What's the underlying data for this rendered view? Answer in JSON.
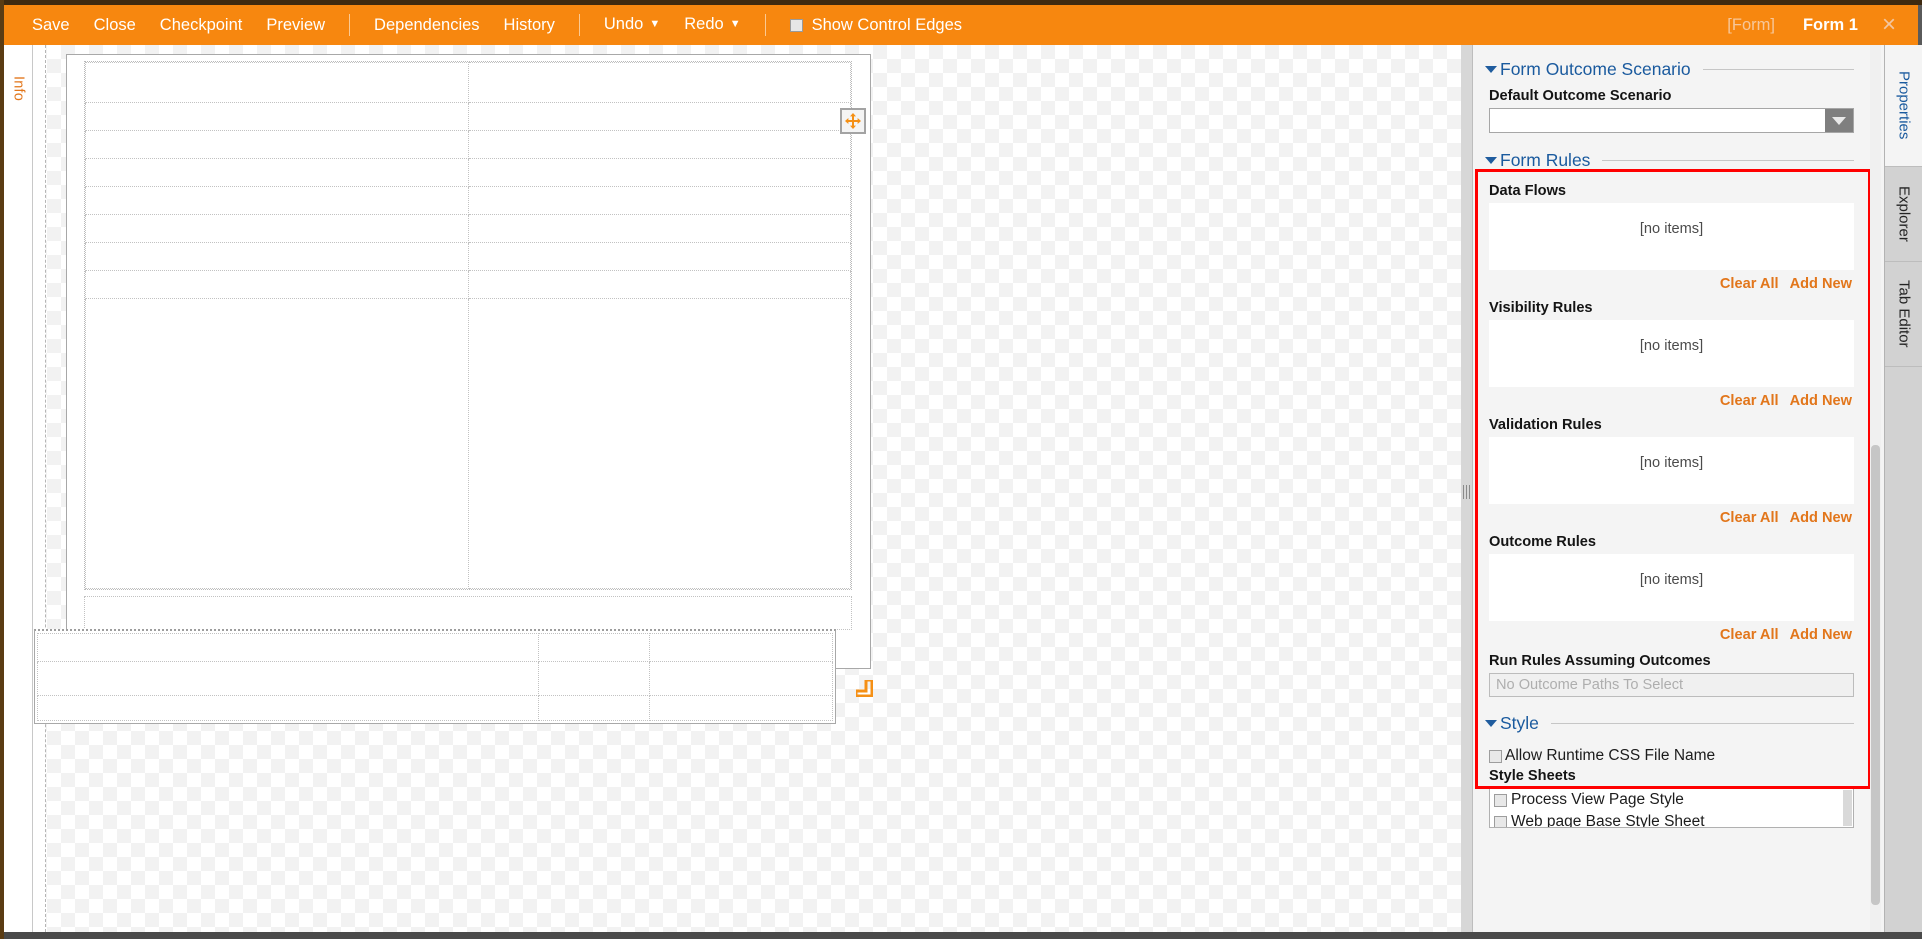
{
  "window": {
    "accent_orange": "#f7870f",
    "highlight_red": "#ff0000",
    "link_orange": "#e2761b",
    "heading_blue": "#1a5a9e"
  },
  "toolbar": {
    "save": "Save",
    "close": "Close",
    "checkpoint": "Checkpoint",
    "preview": "Preview",
    "dependencies": "Dependencies",
    "history": "History",
    "undo": "Undo",
    "redo": "Redo",
    "show_control_edges": "Show Control Edges",
    "show_control_edges_checked": false,
    "breadcrumb_form": "[Form]",
    "active_tab": "Form 1",
    "close_glyph": "×"
  },
  "left_rail": {
    "info_tab": "Info"
  },
  "canvas": {
    "move_handle_name": "move-handle",
    "resize_handle_name": "resize-handle"
  },
  "properties": {
    "outcome_scenario": {
      "group_title": "Form Outcome Scenario",
      "label": "Default Outcome Scenario",
      "value": ""
    },
    "form_rules": {
      "group_title": "Form Rules",
      "clear_all": "Clear All",
      "add_new": "Add New",
      "empty_text": "[no items]",
      "blocks": [
        {
          "title": "Data Flows",
          "items": []
        },
        {
          "title": "Visibility Rules",
          "items": []
        },
        {
          "title": "Validation Rules",
          "items": []
        },
        {
          "title": "Outcome Rules",
          "items": []
        }
      ]
    },
    "run_rules": {
      "label": "Run Rules Assuming Outcomes",
      "placeholder": "No Outcome Paths To Select",
      "value": ""
    },
    "style": {
      "group_title": "Style",
      "allow_runtime_css": "Allow Runtime CSS File Name",
      "allow_runtime_css_checked": false,
      "style_sheets_label": "Style Sheets",
      "style_sheets": [
        {
          "label": "Process View Page Style",
          "checked": false
        },
        {
          "label": "Web page Base Style Sheet",
          "checked": false
        }
      ]
    }
  },
  "right_rail": {
    "tabs": [
      {
        "label": "Properties",
        "active": true
      },
      {
        "label": "Explorer",
        "active": false
      },
      {
        "label": "Tab Editor",
        "active": false
      }
    ]
  }
}
